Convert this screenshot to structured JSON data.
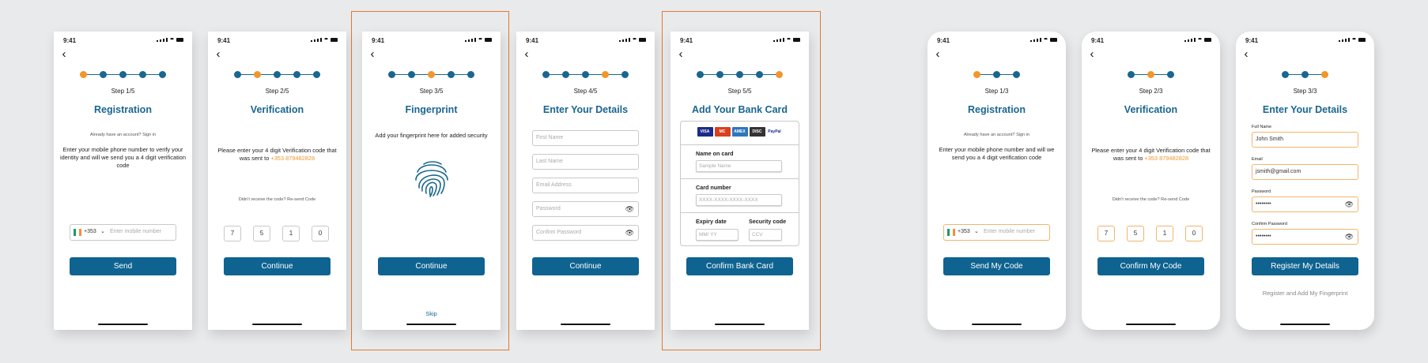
{
  "status_time": "9:41",
  "colors": {
    "primary": "#0f6390",
    "accent": "#f2962c",
    "highlight_border": "#e07b2e"
  },
  "icons": {
    "back": "chevron-left-icon",
    "status": [
      "signal-icon",
      "wifi-icon",
      "battery-icon"
    ],
    "eye": "eye-icon",
    "fingerprint": "fingerprint-icon",
    "flag": "ireland-flag-icon"
  },
  "s1": {
    "step": "Step 1/5",
    "title": "Registration",
    "already": "Already have an account?  Sign in",
    "desc": "Enter your mobile phone number to verify your identity and will we send you a 4 digit verification code",
    "cc": "+353",
    "placeholder": "Enter mobile number",
    "button": "Send"
  },
  "s2": {
    "step": "Step 2/5",
    "title": "Verification",
    "desc": "Please enter your 4 digit Verification code that was sent to",
    "number": "+353 879482828",
    "resend": "Didn't receive the code?   Re-send Code",
    "digits": [
      "7",
      "5",
      "1",
      "0"
    ],
    "button": "Continue"
  },
  "s3": {
    "step": "Step 3/5",
    "title": "Fingerprint",
    "desc": "Add your fingerprint here for added security",
    "button": "Continue",
    "skip": "Skip"
  },
  "s4": {
    "step": "Step 4/5",
    "title": "Enter Your Details",
    "fields": [
      "First Name",
      "Last Name",
      "Email Address",
      "Password",
      "Confirm Password"
    ],
    "button": "Continue"
  },
  "s5": {
    "step": "Step 5/5",
    "title": "Add Your Bank Card",
    "logos": [
      "VISA",
      "MC",
      "AMEX",
      "DISC",
      "PayPal"
    ],
    "name_label": "Name on card",
    "name_ph": "Sample Name",
    "num_label": "Card number",
    "num_ph": "XXXX-XXXX-XXXX-XXXX",
    "exp_label": "Expiry date",
    "sec_label": "Security code",
    "exp_ph": "MM/ YY",
    "ccv_ph": "CCV",
    "button": "Confirm Bank Card"
  },
  "r1": {
    "step": "Step 1/3",
    "title": "Registration",
    "already": "Already have an account?  Sign in",
    "desc": "Enter your mobile phone number and will we send you a 4 digit verification code",
    "cc": "+353",
    "placeholder": "Enter mobile number",
    "button": "Send My Code"
  },
  "r2": {
    "step": "Step 2/3",
    "title": "Verification",
    "desc": "Please enter your 4 digit Verification code that was sent to",
    "number": "+353 879482828",
    "resend": "Didn't receive the code?   Re-send Code",
    "digits": [
      "7",
      "5",
      "1",
      "0"
    ],
    "button": "Confirm My Code"
  },
  "r3": {
    "step": "Step 3/3",
    "title": "Enter Your Details",
    "full_label": "Full Name",
    "full_val": "John Smith",
    "email_label": "Email",
    "email_val": "jsmith@gmail.com",
    "pass_label": "Password",
    "pass_val": "••••••••",
    "cpass_label": "Confirm Password",
    "cpass_val": "••••••••",
    "button": "Register My Details",
    "link": "Register and Add My Fingerprint"
  }
}
